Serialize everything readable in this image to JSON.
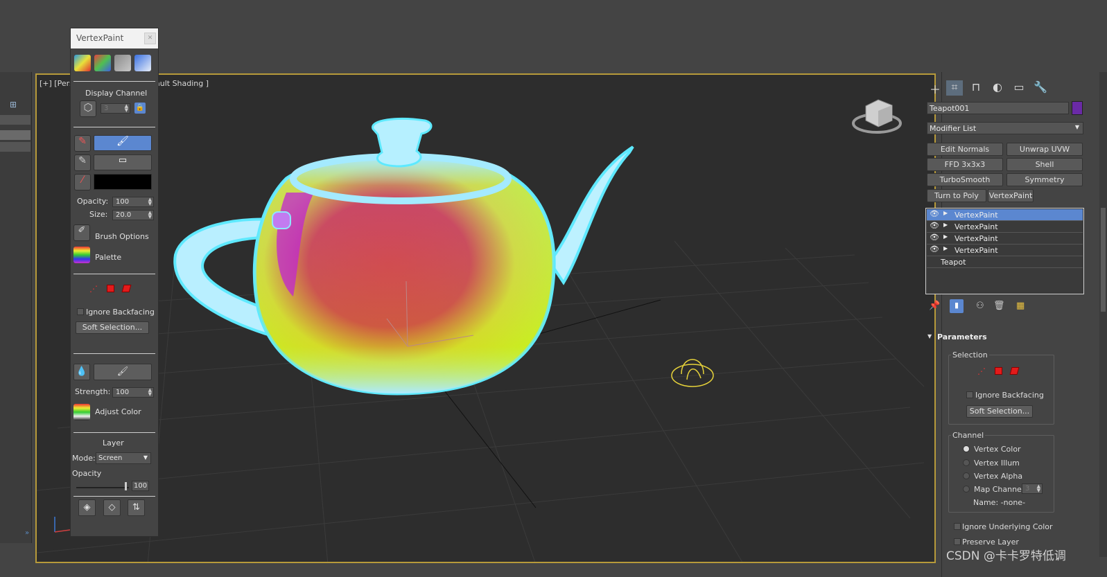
{
  "viewport": {
    "label_left": "[+] [Pers",
    "label_right": "ault Shading ]"
  },
  "vertex_paint_panel": {
    "title": "VertexPaint",
    "close_icon": "close-icon",
    "display_channel_label": "Display Channel",
    "display_channel_value": "3",
    "opacity_label": "Opacity:",
    "opacity_value": "100",
    "size_label": "Size:",
    "size_value": "20.0",
    "brush_options_label": "Brush Options",
    "palette_label": "Palette",
    "ignore_backfacing_label": "Ignore Backfacing",
    "soft_selection_label": "Soft Selection...",
    "strength_label": "Strength:",
    "strength_value": "100",
    "adjust_color_label": "Adjust Color",
    "layer_heading": "Layer",
    "mode_label": "Mode:",
    "mode_value": "Screen",
    "layer_opacity_label": "Opacity",
    "layer_opacity_value": "100",
    "paint_color": "#000000",
    "active_tool_color": "#5b87d0"
  },
  "command_panel": {
    "object_name": "Teapot001",
    "object_color": "#6a2aa6",
    "modifier_list_label": "Modifier List",
    "modifier_buttons": [
      "Edit Normals",
      "Unwrap UVW",
      "FFD 3x3x3",
      "Shell",
      "TurboSmooth",
      "Symmetry",
      "Turn to Poly",
      "VertexPaint"
    ],
    "stack": [
      "VertexPaint",
      "VertexPaint",
      "VertexPaint",
      "VertexPaint",
      "Teapot"
    ],
    "parameters_heading": "Parameters",
    "selection_group": "Selection",
    "ignore_backfacing_label": "Ignore Backfacing",
    "soft_selection_label": "Soft Selection...",
    "channel_group": "Channel",
    "channel_options": [
      "Vertex Color",
      "Vertex Illum",
      "Vertex Alpha",
      "Map Channel"
    ],
    "map_channel_value": "3",
    "name_label": "Name: -none-",
    "ignore_underlying_label": "Ignore Underlying Color",
    "preserve_layer_label": "Preserve Layer"
  },
  "watermark": "CSDN @卡卡罗特低调"
}
